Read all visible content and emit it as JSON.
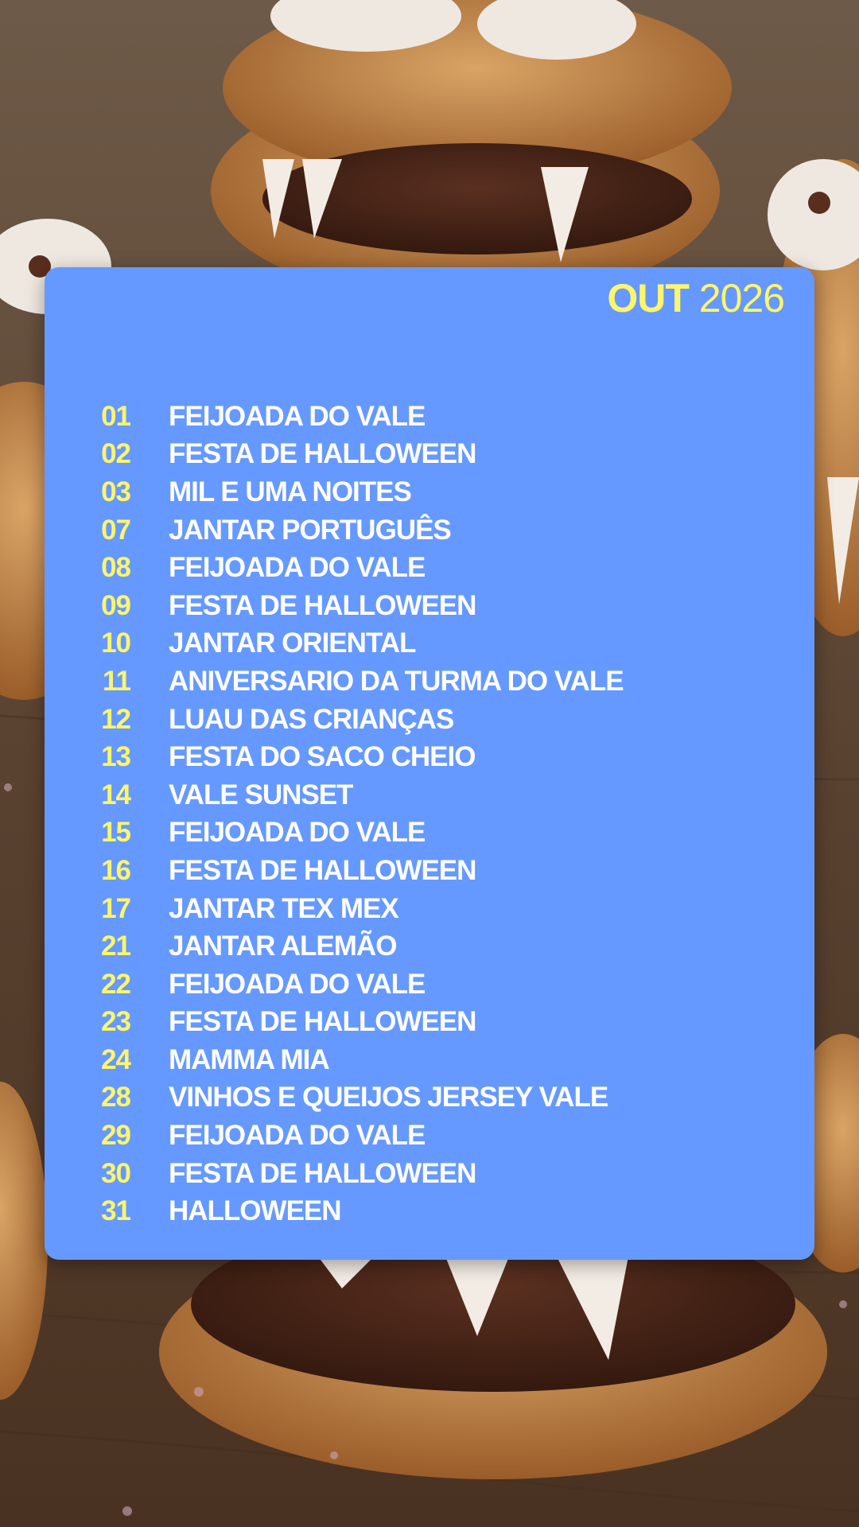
{
  "colors": {
    "card_background": "#6699ff",
    "accent_yellow": "#fdf66a",
    "event_text": "#ffffff"
  },
  "background_image": {
    "icon": "halloween-monster-cookies-photo"
  },
  "header": {
    "month": "OUT",
    "year": "2026"
  },
  "events": [
    {
      "day": "01",
      "name": "FEIJOADA DO VALE"
    },
    {
      "day": "02",
      "name": "FESTA DE HALLOWEEN"
    },
    {
      "day": "03",
      "name": "MIL E UMA NOITES"
    },
    {
      "day": "07",
      "name": "JANTAR PORTUGUÊS"
    },
    {
      "day": "08",
      "name": "FEIJOADA DO VALE"
    },
    {
      "day": "09",
      "name": "FESTA DE HALLOWEEN"
    },
    {
      "day": "10",
      "name": "JANTAR ORIENTAL"
    },
    {
      "day": "11",
      "name": "ANIVERSARIO DA TURMA DO VALE"
    },
    {
      "day": "12",
      "name": "LUAU DAS CRIANÇAS"
    },
    {
      "day": "13",
      "name": "FESTA DO SACO CHEIO"
    },
    {
      "day": "14",
      "name": "VALE SUNSET"
    },
    {
      "day": "15",
      "name": "FEIJOADA DO VALE"
    },
    {
      "day": "16",
      "name": "FESTA DE HALLOWEEN"
    },
    {
      "day": "17",
      "name": "JANTAR TEX MEX"
    },
    {
      "day": "21",
      "name": "JANTAR ALEMÃO"
    },
    {
      "day": "22",
      "name": "FEIJOADA DO VALE"
    },
    {
      "day": "23",
      "name": "FESTA DE HALLOWEEN"
    },
    {
      "day": "24",
      "name": "MAMMA MIA"
    },
    {
      "day": "28",
      "name": "VINHOS E QUEIJOS JERSEY VALE"
    },
    {
      "day": "29",
      "name": "FEIJOADA DO VALE"
    },
    {
      "day": "30",
      "name": "FESTA DE HALLOWEEN"
    },
    {
      "day": "31",
      "name": "HALLOWEEN"
    }
  ]
}
